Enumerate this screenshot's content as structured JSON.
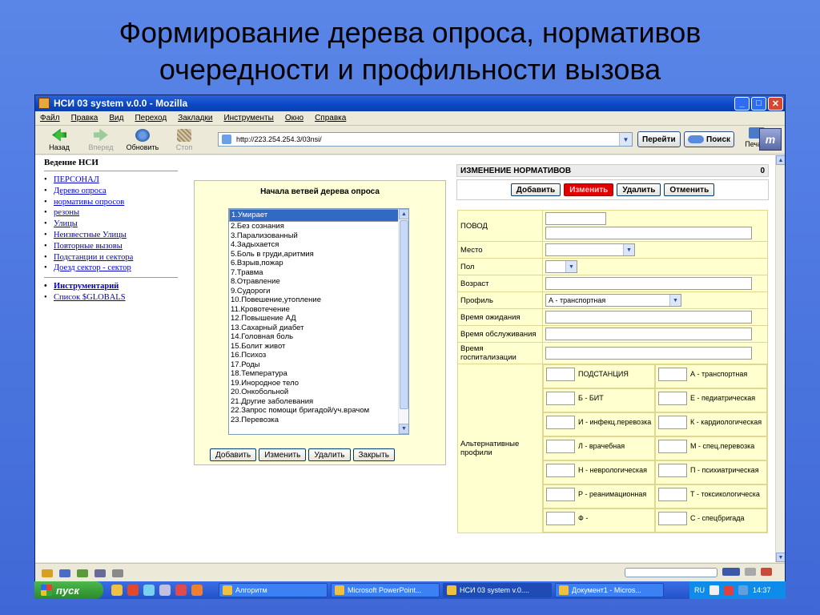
{
  "slide": {
    "title_line1": "Формирование дерева опроса, нормативов",
    "title_line2": "очередности и профильности вызова"
  },
  "window": {
    "title": "НСИ 03 system v.0.0 - Mozilla",
    "menu": [
      "Файл",
      "Правка",
      "Вид",
      "Переход",
      "Закладки",
      "Инструменты",
      "Окно",
      "Справка"
    ],
    "toolbar": {
      "back": "Назад",
      "forward": "Вперед",
      "reload": "Обновить",
      "stop": "Стоп",
      "go": "Перейти",
      "search": "Поиск",
      "print": "Печать"
    },
    "address": "http://223.254.254.3/03nsi/"
  },
  "sidebar": {
    "heading": "Ведение НСИ",
    "items": [
      "ПЕРСОНАЛ",
      "Дерево опроса",
      "нормативы опросов",
      "резоны",
      "Улицы",
      "Неизвестные Улицы",
      "Повторные вызовы",
      "Подстанции и сектора",
      "Доезд сектор - сектор"
    ],
    "items2": [
      "Инструментарий",
      "Список $GLOBALS"
    ]
  },
  "tree": {
    "heading": "Начала ветвей дерева опроса",
    "items": [
      "1.Умирает",
      "2.Без сознания",
      "3.Парализованный",
      "4.Задыхается",
      "5.Боль в груди,аритмия",
      "6.Взрыв,пожар",
      "7.Травма",
      "8.Отравление",
      "9.Судороги",
      "10.Повешение,утопление",
      "11.Кровотечение",
      "12.Повышение АД",
      "13.Сахарный диабет",
      "14.Головная боль",
      "15.Болит живот",
      "16.Психоз",
      "17.Роды",
      "18.Температура",
      "19.Инородное тело",
      "20.Онкобольной",
      "21.Другие заболевания",
      "22.Запрос помощи бригадой/уч.врачом",
      "23.Перевозка"
    ],
    "buttons": [
      "Добавить",
      "Изменить",
      "Удалить",
      "Закрыть"
    ]
  },
  "norms": {
    "heading": "ИЗМЕНЕНИЕ НОРМАТИВОВ",
    "count": "0",
    "buttons": [
      "Добавить",
      "Изменить",
      "Удалить",
      "Отменить"
    ],
    "fields": {
      "povod": "ПОВОД",
      "mesto": "Место",
      "pol": "Пол",
      "vozrast": "Возраст",
      "profil": "Профиль",
      "profil_value": "А - транспортная",
      "wait": "Время ожидания",
      "service": "Время обслуживания",
      "hosp": "Время госпитализации",
      "alt": "Альтернативные профили"
    },
    "alt_profiles": [
      [
        "ПОДСТАНЦИЯ",
        "А - транспортная"
      ],
      [
        "Б - БИТ",
        "Е - педиатрическая"
      ],
      [
        "И - инфекц.перевозка",
        "К - кардиологическая"
      ],
      [
        "Л - врачебная",
        "М - спец.перевозка"
      ],
      [
        "Н - неврологическая",
        "П - психиатрическая"
      ],
      [
        "Р - реанимационная",
        "Т - токсикологическа"
      ],
      [
        "Ф -",
        "С - спецбригада"
      ]
    ]
  },
  "taskbar": {
    "start": "пуск",
    "tasks": [
      "Алгоритм",
      "Microsoft PowerPoint...",
      "НСИ 03 system v.0....",
      "Документ1 - Micros..."
    ],
    "lang": "RU",
    "time": "14:37"
  }
}
